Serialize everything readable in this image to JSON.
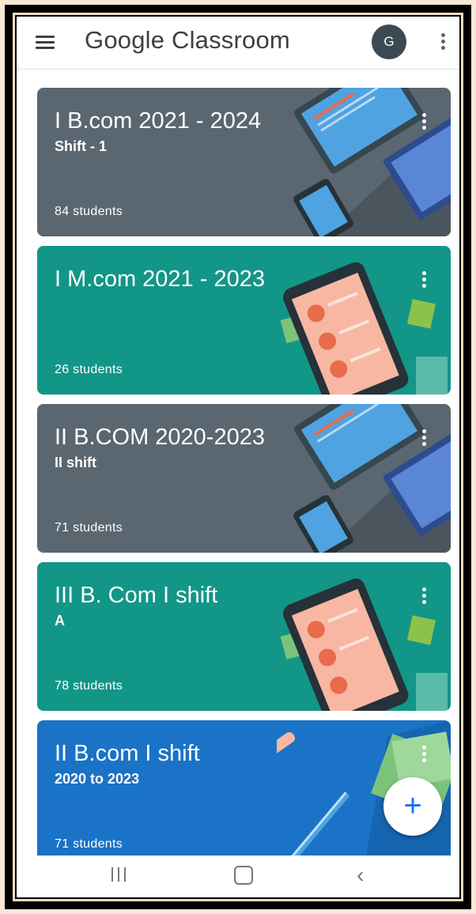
{
  "app": {
    "title": "Google Classroom",
    "avatar_letter": "G"
  },
  "classes": [
    {
      "title": "I B.com 2021 - 2024",
      "subtitle": "Shift - 1",
      "students": "84 students",
      "theme": "gray",
      "color": "#5a6670"
    },
    {
      "title": "I M.com 2021 - 2023",
      "subtitle": "",
      "students": "26 students",
      "theme": "teal",
      "color": "#129688"
    },
    {
      "title": "II B.COM  2020-2023",
      "subtitle": "II shift",
      "students": "71 students",
      "theme": "gray",
      "color": "#5a6670"
    },
    {
      "title": "III B. Com I shift",
      "subtitle": "A",
      "students": "78 students",
      "theme": "teal",
      "color": "#129688"
    },
    {
      "title": "II B.com I shift",
      "subtitle": "2020 to 2023",
      "students": "71 students",
      "theme": "blue",
      "color": "#1a73c6"
    }
  ],
  "fab": {
    "icon": "plus-icon",
    "label": "+"
  },
  "navbar": {
    "recent": "recent-apps-icon",
    "home": "home-icon",
    "back": "back-icon"
  }
}
